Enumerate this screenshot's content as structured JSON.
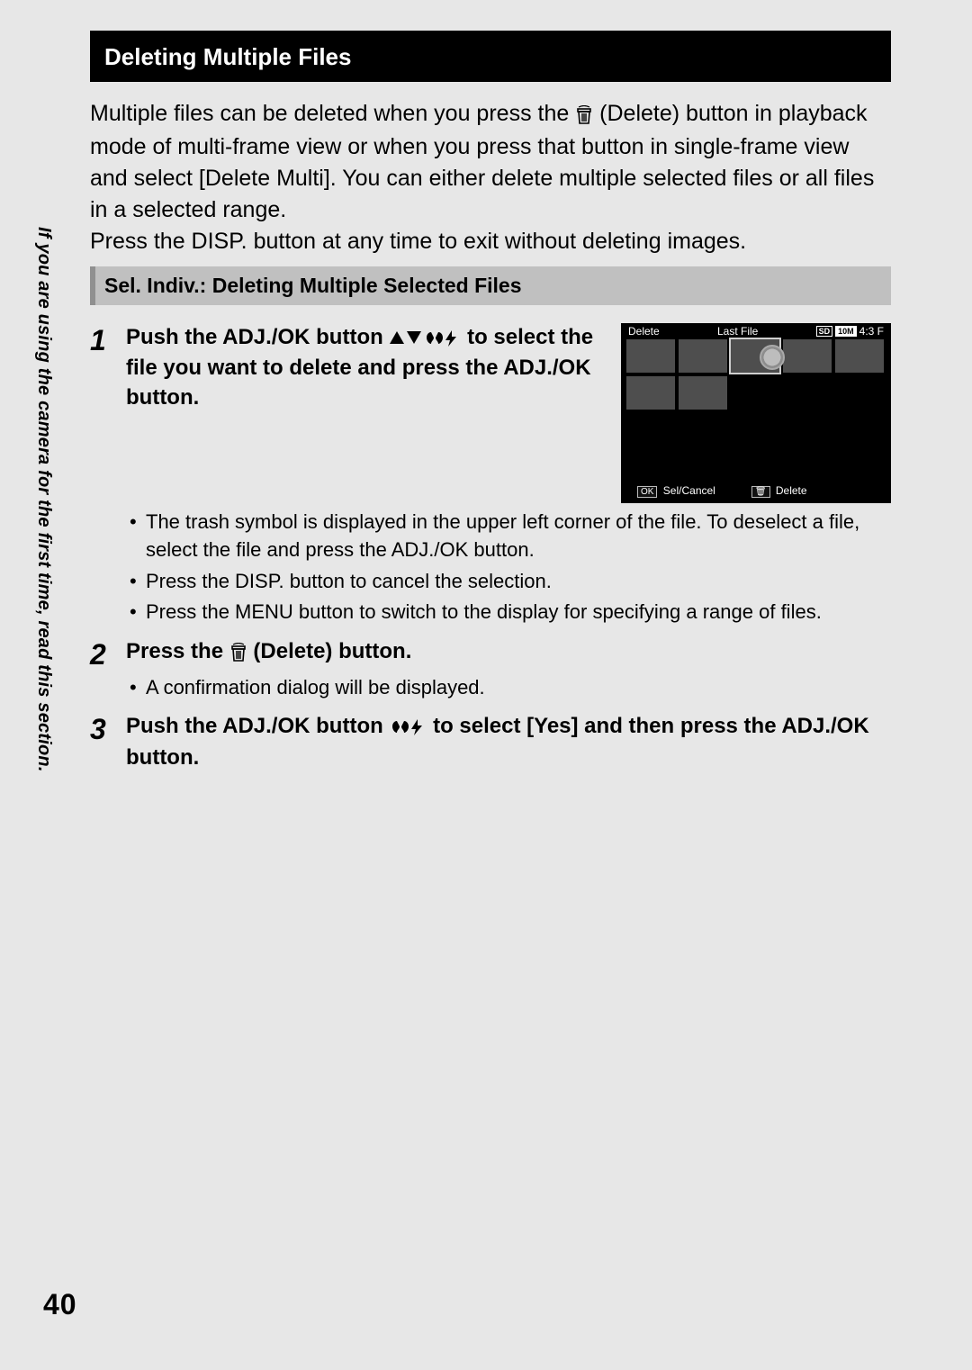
{
  "sideNote": "If you are using the camera for the first time, read this section.",
  "pageNumber": "40",
  "heading_black": "Deleting Multiple Files",
  "intro_p1a": "Multiple files can be deleted when you press the ",
  "intro_p1b": " (Delete) button in playback mode of multi-frame view or when you press that button in single-frame view and select [Delete Multi]. You can either delete multiple selected files or all files in a selected range.",
  "intro_p2": "Press the DISP. button at any time to exit without deleting images.",
  "subheading_gray": "Sel. Indiv.: Deleting Multiple Selected Files",
  "steps": {
    "s1": {
      "num": "1",
      "title_a": "Push the ADJ./OK button ",
      "title_b": " to select the file you want to delete and press the ADJ./OK button.",
      "bullets": {
        "b1": "The trash symbol is displayed in the upper left corner of the file. To deselect a file, select the file and press the ADJ./OK button.",
        "b2": "Press the DISP. button to cancel the selection.",
        "b3": "Press the MENU button to switch to the display for specifying a range of files."
      }
    },
    "s2": {
      "num": "2",
      "title_a": "Press the ",
      "title_b": " (Delete) button.",
      "bullets": {
        "b1": "A confirmation dialog will be displayed."
      }
    },
    "s3": {
      "num": "3",
      "title_a": "Push the ADJ./OK button ",
      "title_b": " to select [Yes] and then press the ADJ./OK button."
    }
  },
  "camera": {
    "delete_label": "Delete",
    "last_file": "Last File",
    "sd": "SD",
    "res": "10M",
    "ratio": "4:3 F",
    "sel_cancel_btn": "OK",
    "sel_cancel": "Sel/Cancel",
    "delete_btn_icon": "🗑",
    "delete_footer": "Delete"
  }
}
